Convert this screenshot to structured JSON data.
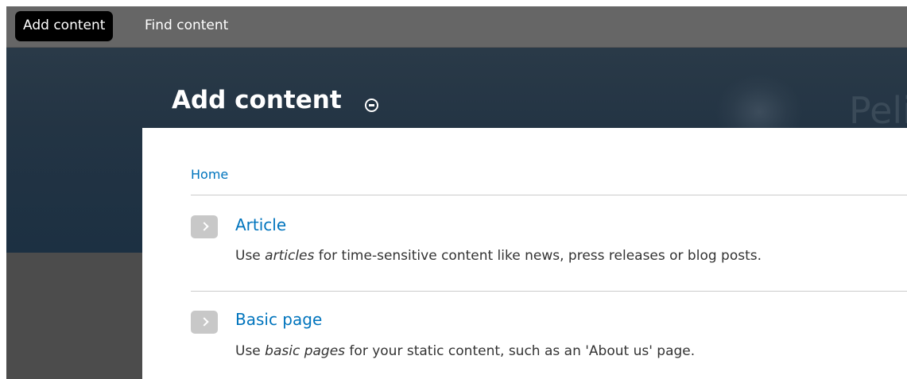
{
  "shortcuts": {
    "items": [
      {
        "label": "Add content",
        "active": true
      },
      {
        "label": "Find content",
        "active": false
      }
    ]
  },
  "header": {
    "page_title": "Add content",
    "site_name_fragment": "Peli",
    "toggle_icon": "minus-circle-icon"
  },
  "breadcrumb": {
    "home": "Home"
  },
  "content_types": [
    {
      "title": "Article",
      "desc_before": "Use ",
      "desc_em": "articles",
      "desc_after": " for time-sensitive content like news, press releases or blog posts.",
      "icon": "chevron-right-icon"
    },
    {
      "title": "Basic page",
      "desc_before": "Use ",
      "desc_em": "basic pages",
      "desc_after": " for your static content, such as an 'About us' page.",
      "icon": "chevron-right-icon"
    }
  ],
  "colors": {
    "link": "#0074bd",
    "toolbar": "#666666",
    "header": "#1f3140"
  }
}
